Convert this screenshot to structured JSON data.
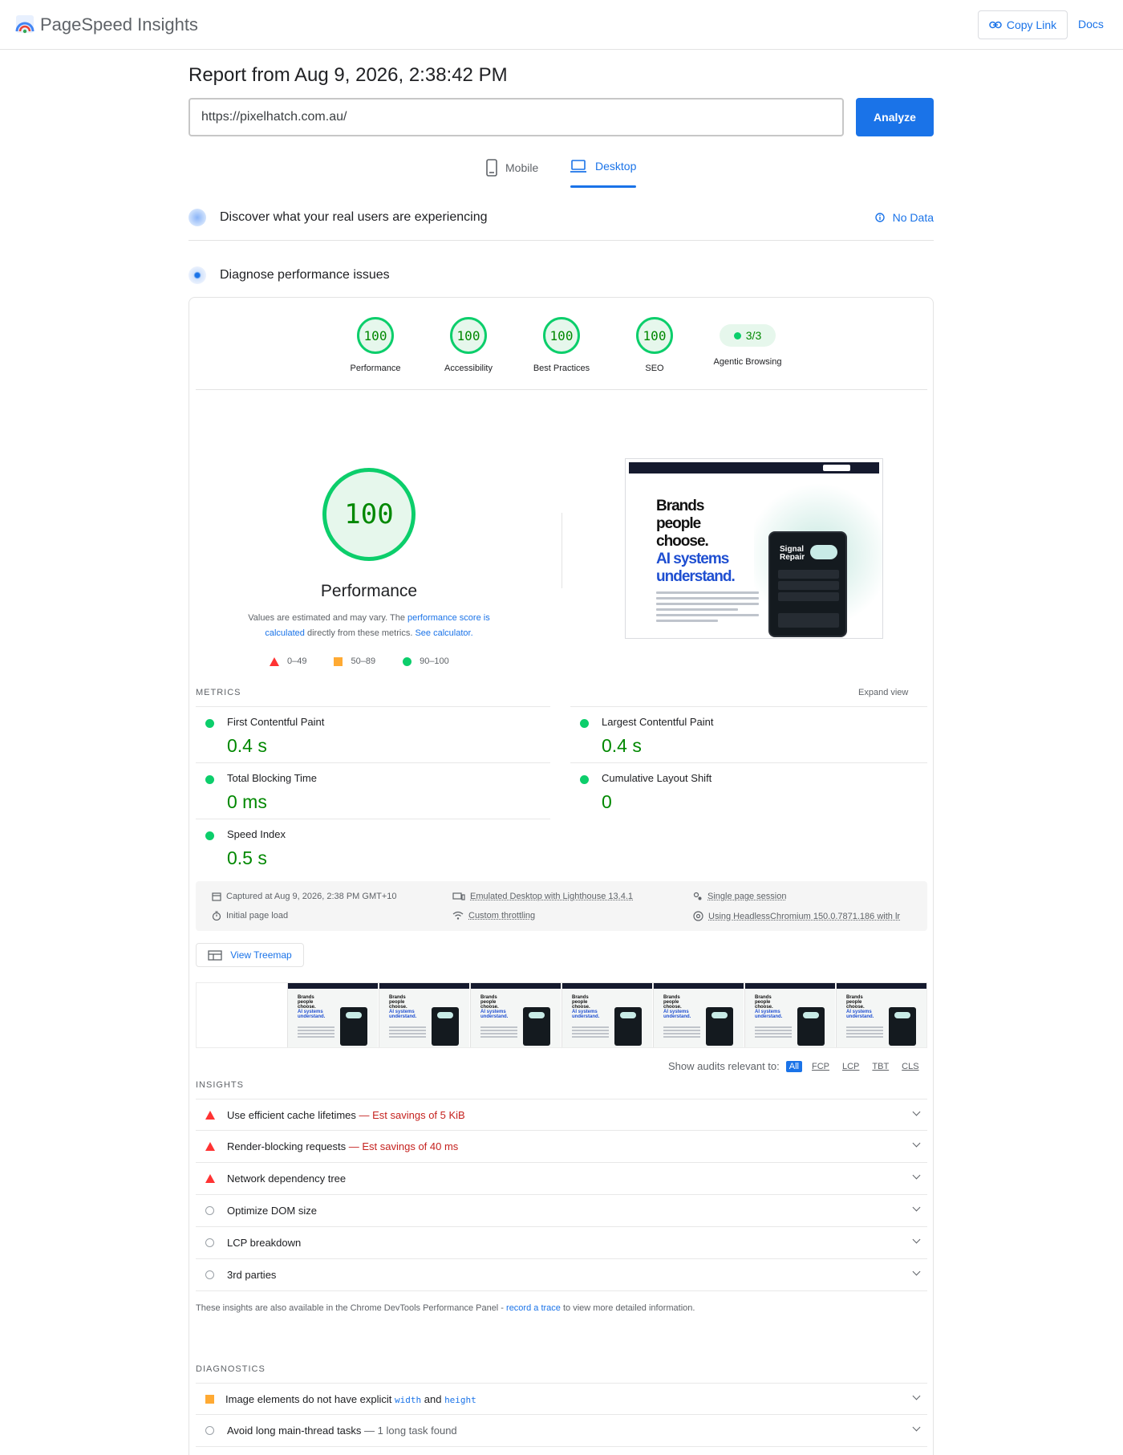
{
  "app": {
    "title": "PageSpeed Insights",
    "copy_link": "Copy Link",
    "docs": "Docs"
  },
  "report": {
    "title": "Report from Aug 9, 2026, 2:38:42 PM",
    "url": "https://pixelhatch.com.au/",
    "analyze": "Analyze"
  },
  "tabs": {
    "mobile": "Mobile",
    "desktop": "Desktop",
    "selected": "Desktop"
  },
  "real_users": {
    "label": "Discover what your real users are experiencing",
    "status": "No Data"
  },
  "diagnose": {
    "label": "Diagnose performance issues"
  },
  "categories": [
    {
      "score": "100",
      "label": "Performance"
    },
    {
      "score": "100",
      "label": "Accessibility"
    },
    {
      "score": "100",
      "label": "Best Practices"
    },
    {
      "score": "100",
      "label": "SEO"
    },
    {
      "score": "3/3",
      "label": "Agentic Browsing"
    }
  ],
  "performance": {
    "score": "100",
    "title": "Performance",
    "desc_1": "Values are estimated and may vary. The ",
    "desc_link_1": "performance score is calculated",
    "desc_2": " directly from these metrics. ",
    "desc_link_2": "See calculator.",
    "legend": [
      "0–49",
      "50–89",
      "90–100"
    ]
  },
  "screenshot": {
    "headline_1": "Brands",
    "headline_2": "people",
    "headline_3": "choose.",
    "headline_4": "AI systems",
    "headline_5": "understand.",
    "phone_title_1": "Signal",
    "phone_title_2": "Repair"
  },
  "metrics": {
    "heading": "METRICS",
    "expand": "Expand view",
    "items": [
      {
        "name": "First Contentful Paint",
        "value": "0.4 s"
      },
      {
        "name": "Largest Contentful Paint",
        "value": "0.4 s"
      },
      {
        "name": "Total Blocking Time",
        "value": "0 ms"
      },
      {
        "name": "Cumulative Layout Shift",
        "value": "0"
      },
      {
        "name": "Speed Index",
        "value": "0.5 s"
      }
    ]
  },
  "runtime": {
    "captured": "Captured at Aug 9, 2026, 2:38 PM GMT+10",
    "initial": "Initial page load",
    "emulated": "Emulated Desktop with Lighthouse 13.4.1",
    "throttling": "Custom throttling",
    "session": "Single page session",
    "browser": "Using HeadlessChromium 150.0.7871.186 with lr"
  },
  "treemap": "View Treemap",
  "audit_filter": {
    "label": "Show audits relevant to:",
    "chips": [
      "All",
      "FCP",
      "LCP",
      "TBT",
      "CLS"
    ]
  },
  "insights": {
    "heading": "INSIGHTS",
    "items": [
      {
        "title": "Use efficient cache lifetimes",
        "savings": " — Est savings of 5 KiB",
        "status": "fail"
      },
      {
        "title": "Render-blocking requests",
        "savings": " — Est savings of 40 ms",
        "status": "fail"
      },
      {
        "title": "Network dependency tree",
        "savings": "",
        "status": "fail"
      },
      {
        "title": "Optimize DOM size",
        "savings": "",
        "status": "info"
      },
      {
        "title": "LCP breakdown",
        "savings": "",
        "status": "info"
      },
      {
        "title": "3rd parties",
        "savings": "",
        "status": "info"
      }
    ],
    "note_1": "These insights are also available in the Chrome DevTools Performance Panel - ",
    "note_link": "record a trace",
    "note_2": " to view more detailed information."
  },
  "diagnostics": {
    "heading": "DIAGNOSTICS",
    "item_1_a": "Image elements do not have explicit ",
    "item_1_code_1": "width",
    "item_1_b": " and ",
    "item_1_code_2": "height",
    "item_2": "Avoid long main-thread tasks",
    "item_2_sub": " — 1 long task found"
  },
  "colors": {
    "accent": "#1a73e8",
    "pass": "#0cce6b",
    "pass_text": "#008800",
    "fail": "#ff3333",
    "average": "#ffaa33"
  }
}
